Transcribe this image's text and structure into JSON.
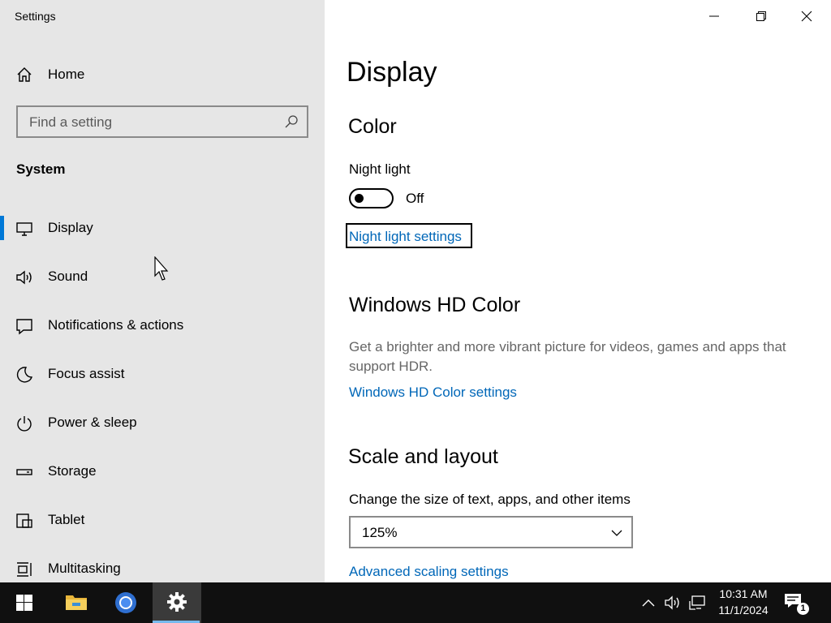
{
  "window": {
    "title": "Settings"
  },
  "sidebar": {
    "home_label": "Home",
    "search_placeholder": "Find a setting",
    "section_title": "System",
    "items": [
      {
        "label": "Display",
        "icon": "monitor-icon",
        "selected": true
      },
      {
        "label": "Sound",
        "icon": "speaker-icon"
      },
      {
        "label": "Notifications & actions",
        "icon": "notifications-icon"
      },
      {
        "label": "Focus assist",
        "icon": "moon-icon"
      },
      {
        "label": "Power & sleep",
        "icon": "power-icon"
      },
      {
        "label": "Storage",
        "icon": "storage-icon"
      },
      {
        "label": "Tablet",
        "icon": "tablet-icon"
      },
      {
        "label": "Multitasking",
        "icon": "multitasking-icon"
      }
    ]
  },
  "main": {
    "page_title": "Display",
    "color": {
      "heading": "Color",
      "night_light_label": "Night light",
      "night_light_state": "Off",
      "night_light_link": "Night light settings"
    },
    "hdr": {
      "heading": "Windows HD Color",
      "description": "Get a brighter and more vibrant picture for videos, games and apps that support HDR.",
      "link": "Windows HD Color settings"
    },
    "scale": {
      "heading": "Scale and layout",
      "label": "Change the size of text, apps, and other items",
      "selected_value": "125%",
      "link": "Advanced scaling settings"
    }
  },
  "taskbar": {
    "time": "10:31 AM",
    "date": "11/1/2024",
    "notification_count": "1",
    "active_color": "#76b9ed"
  },
  "colors": {
    "accent": "#0078d7",
    "link": "#0067b8",
    "sidebar_bg": "#e6e6e6"
  }
}
